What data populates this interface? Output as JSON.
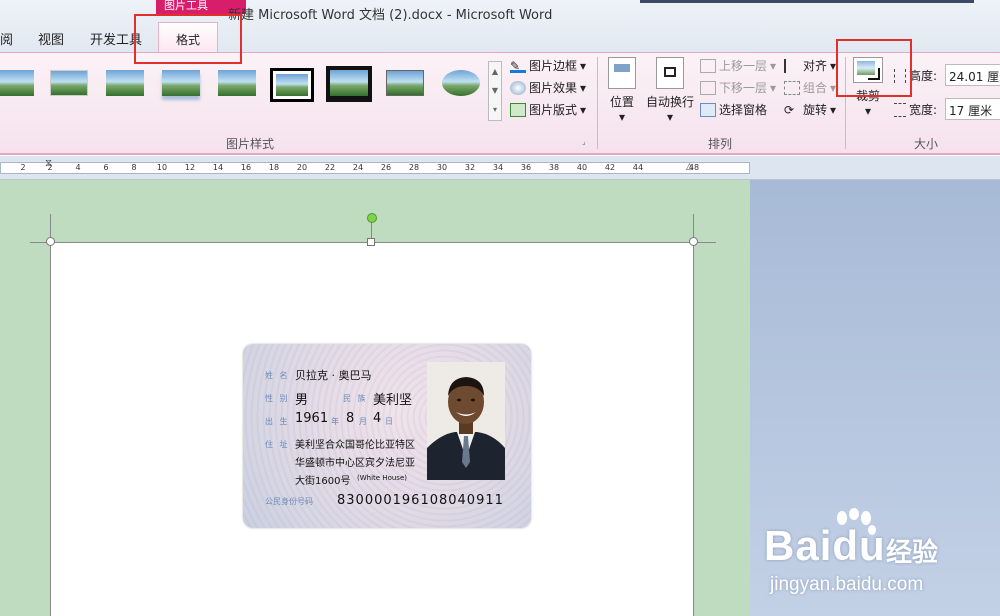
{
  "window": {
    "context_header": "图片工具",
    "title": "新建 Microsoft Word 文档 (2).docx  -  Microsoft Word"
  },
  "tabs": [
    {
      "label": "阅"
    },
    {
      "label": "视图"
    },
    {
      "label": "开发工具"
    }
  ],
  "active_tab": {
    "label": "格式"
  },
  "ribbon": {
    "picture_styles": {
      "group_label": "图片样式",
      "border_label": "图片边框",
      "effects_label": "图片效果",
      "layout_label": "图片版式"
    },
    "arrange": {
      "group_label": "排列",
      "position_label": "位置",
      "wrap_label": "自动换行",
      "bring_forward_label": "上移一层",
      "send_backward_label": "下移一层",
      "selection_pane_label": "选择窗格",
      "align_label": "对齐",
      "group_cmd_label": "组合",
      "rotate_label": "旋转"
    },
    "size": {
      "group_label": "大小",
      "crop_label": "裁剪",
      "height_label": "高度:",
      "height_value": "24.01 厘米",
      "width_label": "宽度:",
      "width_value": "17 厘米"
    }
  },
  "ruler": {
    "ticks": [
      "2",
      "2",
      "4",
      "6",
      "8",
      "10",
      "12",
      "14",
      "16",
      "18",
      "20",
      "22",
      "24",
      "26",
      "28",
      "30",
      "32",
      "34",
      "36",
      "38",
      "40",
      "42",
      "44",
      "",
      "48"
    ]
  },
  "id_card": {
    "name_label": "姓 名",
    "name_value": "贝拉克 · 奥巴马",
    "sex_label": "性 别",
    "sex_value": "男",
    "ethnic_label": "民 族",
    "ethnic_value": "美利坚",
    "birth_label": "出 生",
    "birth_year": "1961",
    "birth_year_unit": "年",
    "birth_month": "8",
    "birth_month_unit": "月",
    "birth_day": "4",
    "birth_day_unit": "日",
    "address_label": "住 址",
    "address_line1": "美利坚合众国哥伦比亚特区",
    "address_line2": "华盛顿市中心区宾夕法尼亚",
    "address_line3": "大街1600号",
    "address_note": "(White House)",
    "id_label": "公民身份号码",
    "id_value": "830000196108040911"
  },
  "watermark": {
    "brand": "Bai",
    "brand_tail": "du",
    "cn": "经验",
    "url": "jingyan.baidu.com"
  }
}
